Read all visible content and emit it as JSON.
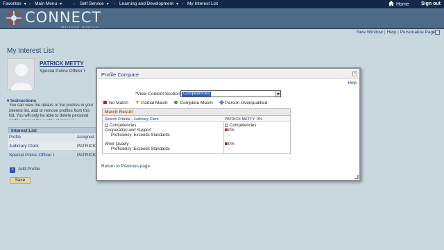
{
  "topnav": {
    "favorites": "Favorites",
    "main_menu": "Main Menu",
    "self_service": "Self Service",
    "learning": "Learning and Development",
    "interest_list": "My Interest List",
    "separator": "›",
    "home": "Home",
    "sign_out": "Sign out"
  },
  "banner": {
    "brand": "CONNECT",
    "sub": "Maryland Judiciary"
  },
  "pagelinks": {
    "new_window": "New Window",
    "help": "Help",
    "personalize": "Personalize Page",
    "sep": "|"
  },
  "page": {
    "title": "My Interest List",
    "person_name": "PATRICK METTY",
    "person_title": "Special Police Officer I",
    "instructions_heading": "Instructions",
    "instructions_text": "You can view the details of the profiles in your interest list, add or remove profiles from this list. You will only be able to delete personal profile against the profile of interest."
  },
  "interest_list": {
    "header": "Interest List",
    "col_profile": "Profile",
    "col_assigned": "Assigned",
    "rows": [
      {
        "profile": "Judiciary Clerk",
        "assigned": "PATRICK"
      },
      {
        "profile": "Special Police Officer I",
        "assigned": "PATRICK"
      }
    ],
    "add_profile": "Add Profile",
    "save": "Save"
  },
  "modal": {
    "title": "Profile Compare",
    "close": "×",
    "help": "Help",
    "view_label": "*View Content Section",
    "view_value": "Competencies",
    "legend": {
      "no_match": "No Match",
      "partial_match": "Partial Match",
      "complete_match": "Complete Match",
      "overqualified": "Person Overqualified"
    },
    "result": {
      "title": "Match Result",
      "search_criteria": "Search Criteria - Judiciary Clerk",
      "person_col": "PATRICK METTY: 0%",
      "left_section": "Competencies",
      "right_section": "Competencies",
      "item1": "Cooperation and Support :",
      "item1_prof": "Proficiency: Exceeds Standards",
      "item1_pct": "0%",
      "item1_dash": "--",
      "item2": "Work Quality :",
      "item2_prof": "Proficiency: Exceeds Standards",
      "item2_pct": "0%",
      "item2_dash": "--"
    },
    "return_link": "Return to Previous page"
  },
  "colors": {
    "nav_bg": "#12294a",
    "banner_bg": "#4d6a87",
    "page_bg": "#c9d8df",
    "link": "#1f3d7a",
    "no_match": "#c81e1e",
    "partial": "#e0b400",
    "complete": "#2ea02e",
    "overqualified": "#4d88d0"
  }
}
